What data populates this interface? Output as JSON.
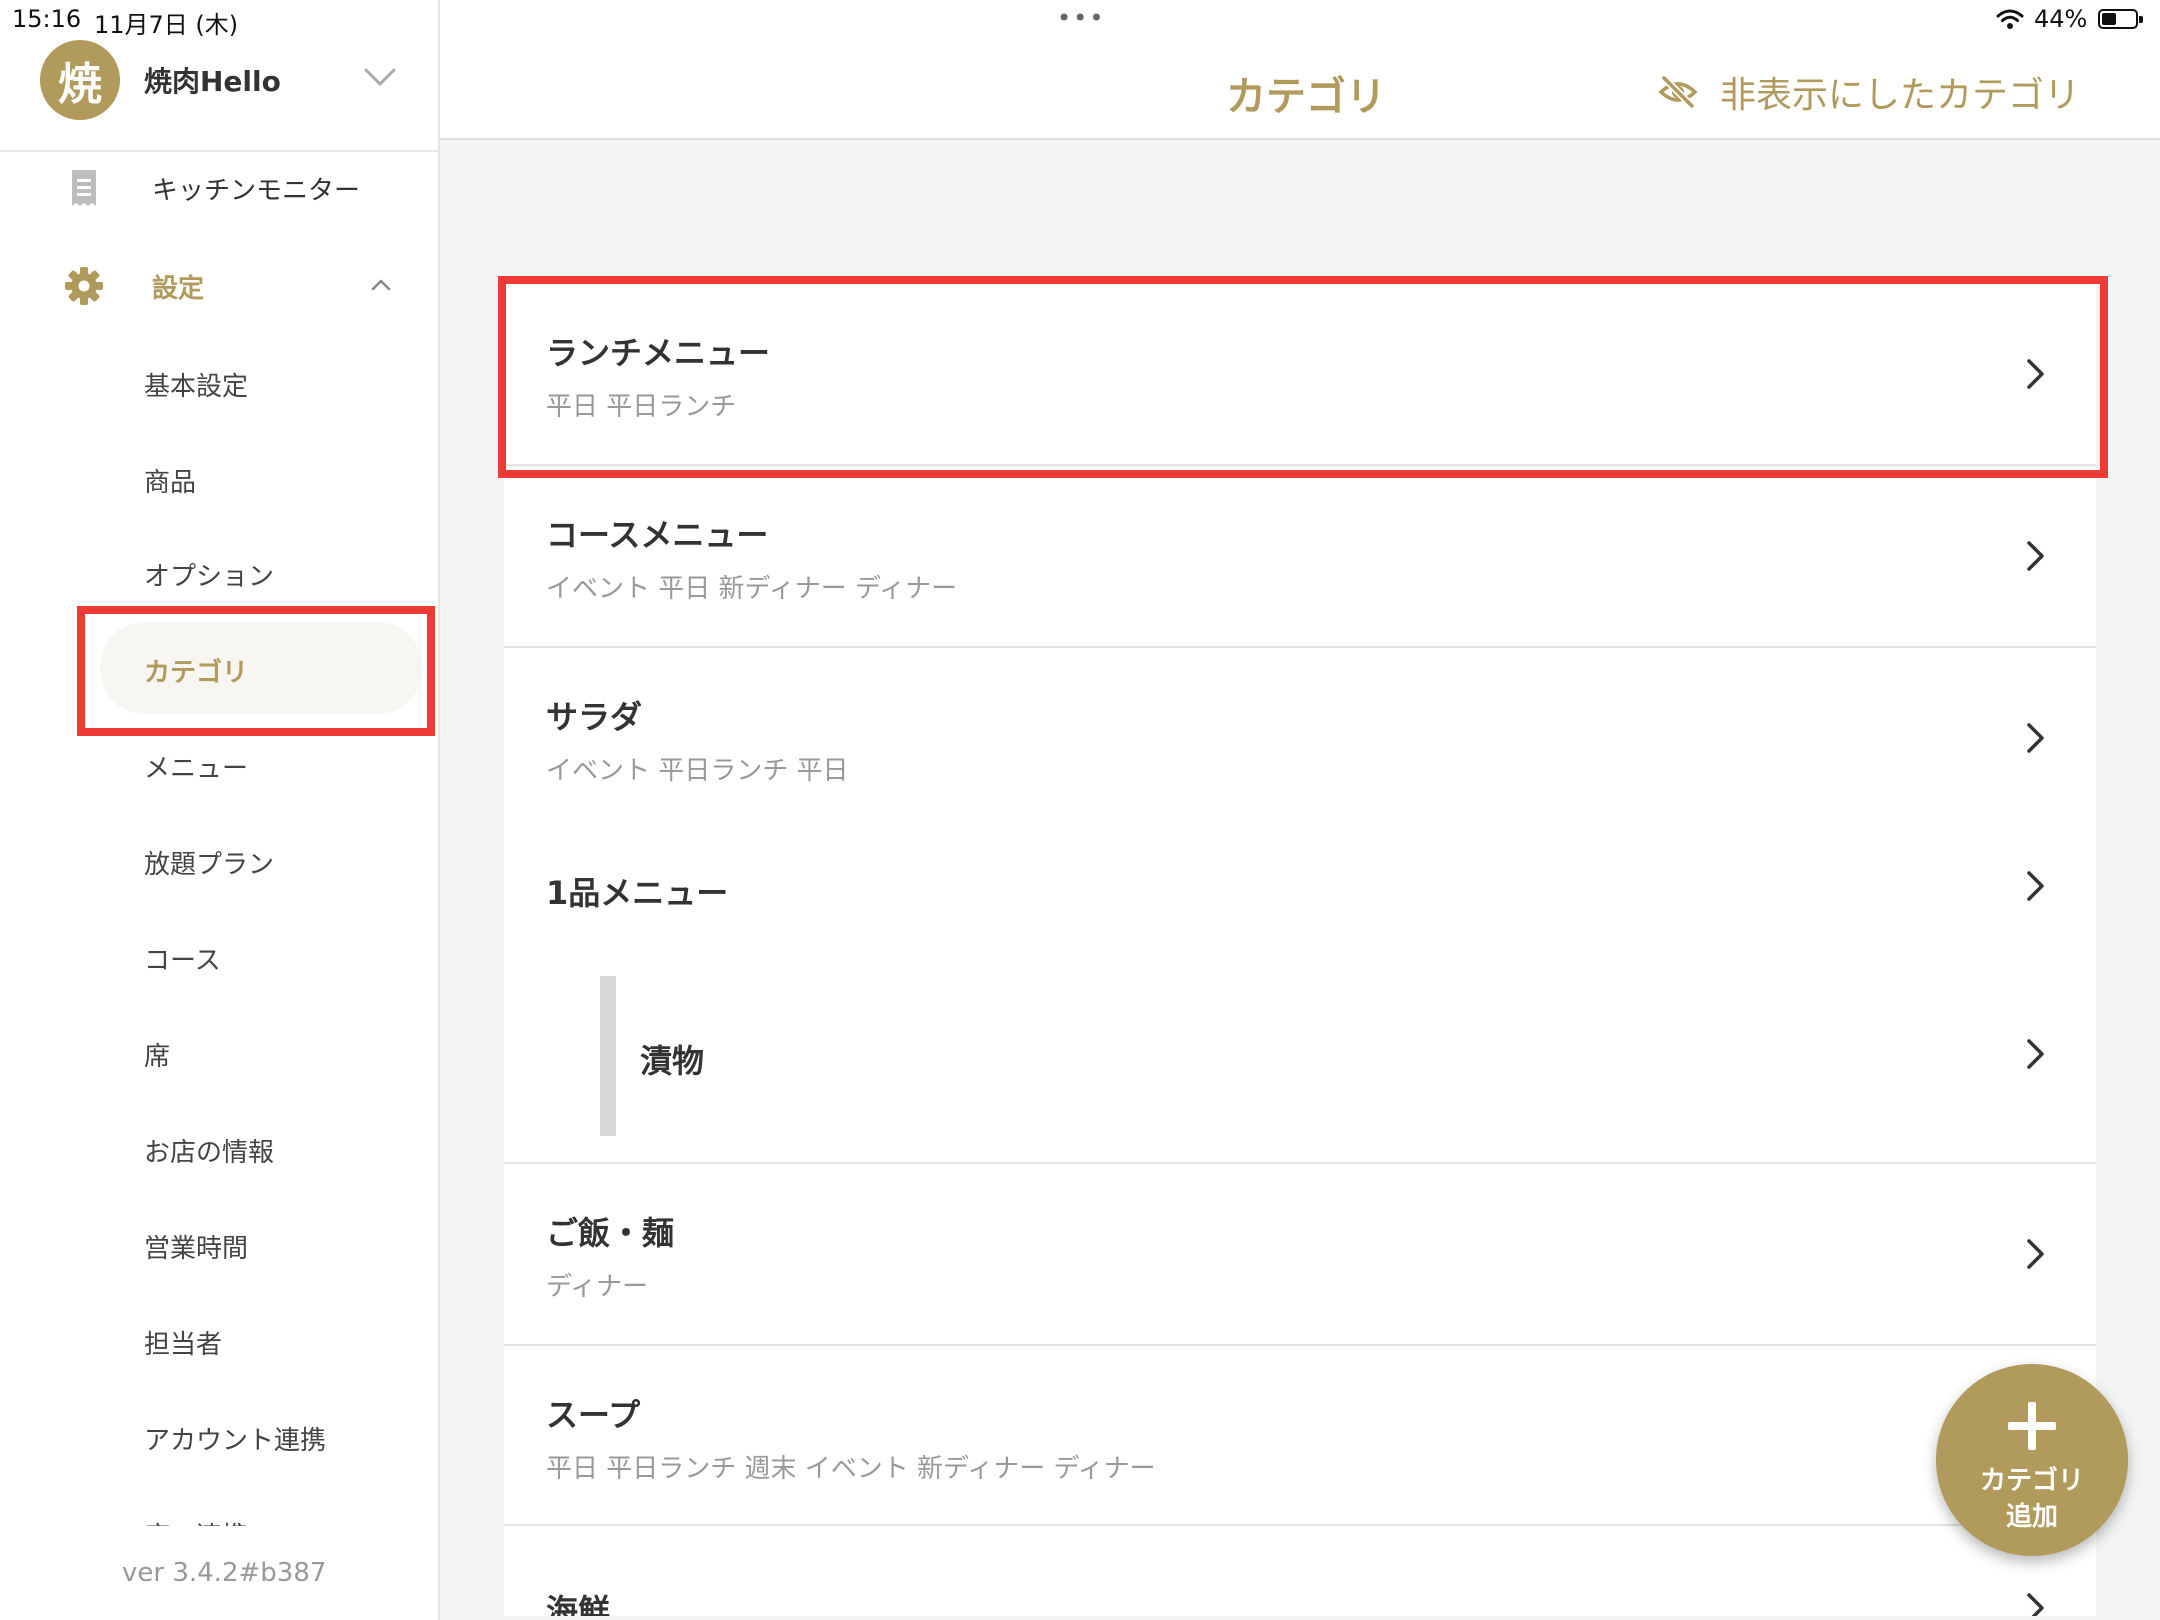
{
  "status_bar": {
    "time": "15:16",
    "date": "11月7日 (木)",
    "dots": "•••",
    "battery": "44%",
    "battery_level": 0.44
  },
  "sidebar": {
    "store_initial": "焼",
    "store_name": "焼肉Hello",
    "kitchen_monitor": "キッチンモニター",
    "settings": "設定",
    "items": [
      "基本設定",
      "商品",
      "オプション",
      "カテゴリ",
      "メニュー",
      "放題プラン",
      "コース",
      "席",
      "お店の情報",
      "営業時間",
      "担当者",
      "アカウント連携",
      "席の連携"
    ],
    "active_index": 3,
    "version": "ver 3.4.2#b387"
  },
  "header": {
    "title": "カテゴリ",
    "hidden_link": "非表示にしたカテゴリ"
  },
  "categories": [
    {
      "name": "ランチメニュー",
      "tags": "平日 平日ランチ"
    },
    {
      "name": "コースメニュー",
      "tags": "イベント 平日 新ディナー ディナー"
    },
    {
      "name": "サラダ",
      "tags": "イベント 平日ランチ 平日"
    },
    {
      "name": "1品メニュー",
      "tags": ""
    },
    {
      "name": "漬物",
      "tags": "",
      "child": true
    },
    {
      "name": "ご飯・麺",
      "tags": "ディナー"
    },
    {
      "name": "スープ",
      "tags": "平日 平日ランチ 週末 イベント 新ディナー ディナー"
    },
    {
      "name": "海鮮",
      "tags": ""
    }
  ],
  "fab": {
    "line1": "カテゴリ",
    "line2": "追加"
  },
  "colors": {
    "accent": "#b09a5c",
    "highlight": "#ee3b36"
  }
}
